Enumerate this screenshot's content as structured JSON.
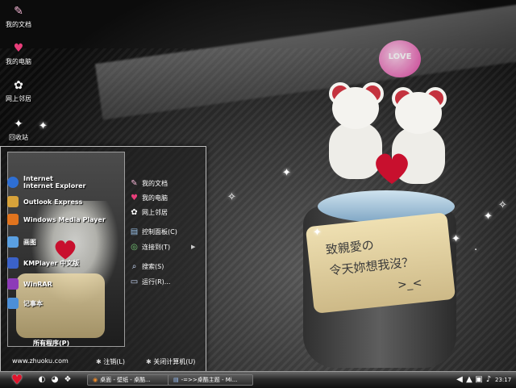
{
  "desktop": {
    "icons": [
      {
        "name": "my-documents-icon",
        "label": "我的文档",
        "glyph": "✎"
      },
      {
        "name": "my-computer-icon",
        "label": "我的电脑",
        "glyph": "♥"
      },
      {
        "name": "network-places-icon",
        "label": "网上邻居",
        "glyph": "✿"
      },
      {
        "name": "recycle-bin-icon",
        "label": "回收站",
        "glyph": "✦"
      }
    ],
    "cup_text": [
      "致親愛の",
      "令天妳想我沒？"
    ],
    "cup_doodle": ">_<",
    "balloon_text": "LOVE"
  },
  "start_menu": {
    "programs": [
      {
        "label": "Internet\nInternet Explorer",
        "color": "#2e6fd4"
      },
      {
        "label": "Outlook Express",
        "color": "#d7a23a"
      },
      {
        "label": "Windows Media Player",
        "color": "#e1741e"
      },
      {
        "label": "画图",
        "color": "#5aa0e2"
      },
      {
        "label": "KMPlayer 中文版",
        "color": "#3b62c9"
      },
      {
        "label": "WinRAR",
        "color": "#8d3bb8"
      },
      {
        "label": "记事本",
        "color": "#4c8fd8"
      }
    ],
    "all_programs": "所有程序(P)",
    "places": [
      {
        "label": "我的文档",
        "glyph": "✎"
      },
      {
        "label": "我的电脑",
        "glyph": "♥"
      },
      {
        "label": "网上邻居",
        "glyph": "✿"
      },
      {
        "label": "控制面板(C)",
        "glyph": "▤"
      },
      {
        "label": "连接到(T)",
        "glyph": "◎"
      },
      {
        "label": "搜索(S)",
        "glyph": "⌕"
      },
      {
        "label": "运行(R)...",
        "glyph": "▭"
      }
    ],
    "submenu_arrow": "▶",
    "website": "www.zhuoku.com",
    "logoff": "注销(L)",
    "shutdown": "关闭计算机(U)"
  },
  "taskbar": {
    "start_glyph": "♥",
    "quick_launch": [
      "◐",
      "◕",
      "❖"
    ],
    "tasks": [
      {
        "label": "桌面 - 壁纸 - 桌酷..."
      },
      {
        "label": "-=>>桌酷主题 - Mi..."
      }
    ],
    "tray_icons": [
      "◀",
      "▲",
      "▣",
      "♪"
    ],
    "clock": "23:17"
  }
}
